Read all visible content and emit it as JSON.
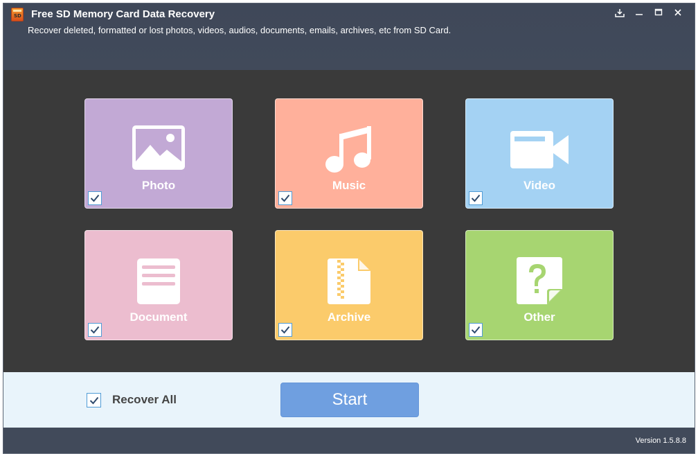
{
  "window": {
    "title": "Free SD Memory Card Data Recovery",
    "subtitle": "Recover deleted, formatted or lost photos, videos, audios, documents, emails, archives, etc from SD Card.",
    "controls": [
      "download-icon",
      "minimize-icon",
      "maximize-icon",
      "close-icon"
    ]
  },
  "file_types": [
    {
      "label": "Photo",
      "icon": "photo-icon",
      "color": "#c2a9d5",
      "checked": true
    },
    {
      "label": "Music",
      "icon": "music-note-icon",
      "color": "#ffb09b",
      "checked": true
    },
    {
      "label": "Video",
      "icon": "video-camera-icon",
      "color": "#a4d2f3",
      "checked": true
    },
    {
      "label": "Document",
      "icon": "document-icon",
      "color": "#ecbdcf",
      "checked": true
    },
    {
      "label": "Archive",
      "icon": "zip-archive-icon",
      "color": "#fbcb6b",
      "checked": true
    },
    {
      "label": "Other",
      "icon": "question-file-icon",
      "color": "#a7d571",
      "checked": true
    }
  ],
  "bottom": {
    "recover_all_label": "Recover All",
    "recover_all_checked": true,
    "start_label": "Start"
  },
  "status": {
    "version": "Version 1.5.8.8"
  }
}
